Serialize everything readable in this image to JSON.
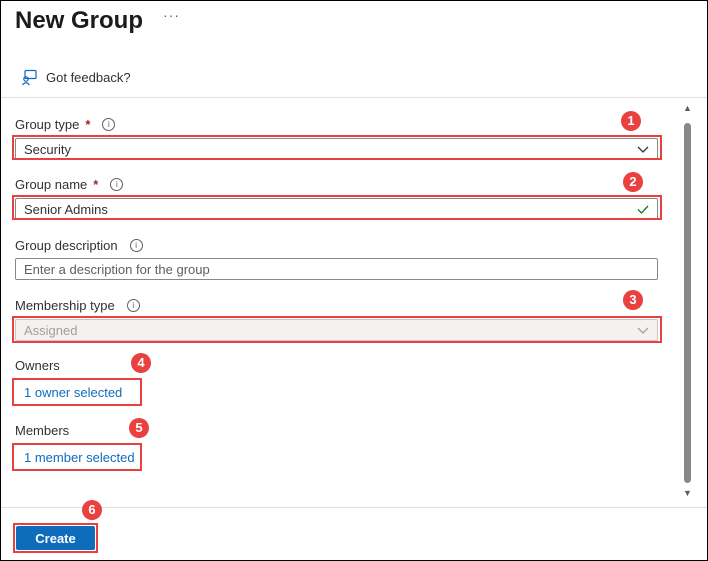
{
  "title": "New Group",
  "more_label": "···",
  "feedback": {
    "label": "Got feedback?",
    "icon": "feedback-icon"
  },
  "form": {
    "group_type": {
      "label": "Group type",
      "required_mark": "*",
      "value": "Security"
    },
    "group_name": {
      "label": "Group name",
      "required_mark": "*",
      "value": "Senior Admins"
    },
    "group_description": {
      "label": "Group description",
      "placeholder": "Enter a description for the group"
    },
    "membership_type": {
      "label": "Membership type",
      "value": "Assigned"
    },
    "owners": {
      "label": "Owners",
      "link": "1 owner selected"
    },
    "members": {
      "label": "Members",
      "link": "1 member selected"
    }
  },
  "info_glyph": "i",
  "callouts": [
    "1",
    "2",
    "3",
    "4",
    "5",
    "6"
  ],
  "create_label": "Create",
  "colors": {
    "accent": "#0f6cbd",
    "callout": "#e8413f",
    "valid": "#107c10"
  }
}
